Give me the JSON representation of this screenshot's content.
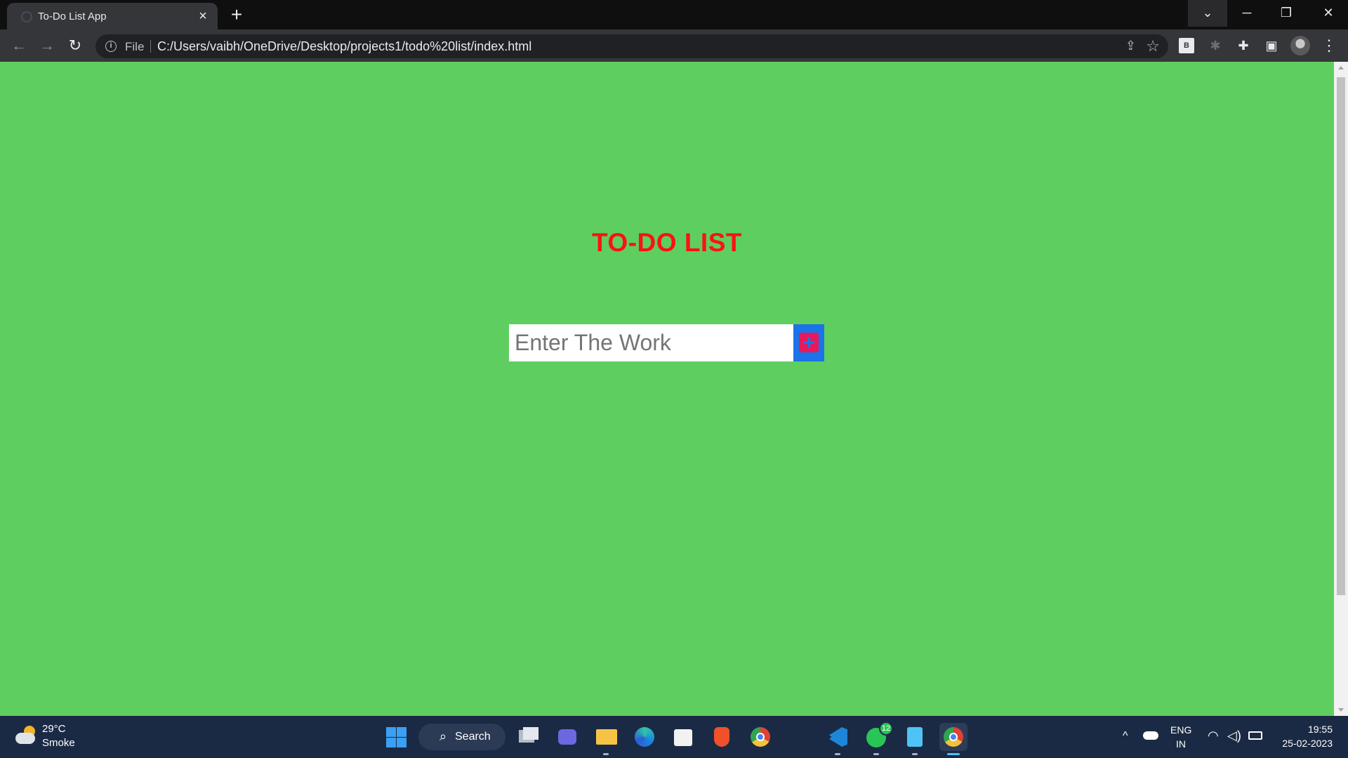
{
  "browser": {
    "tab_title": "To-Do List App",
    "tab_close_icon": "×",
    "new_tab_icon": "+",
    "window_controls": {
      "dropdown": "⌄",
      "minimize": "─",
      "maximize": "❐",
      "close": "✕"
    },
    "nav": {
      "back": "←",
      "forward": "→",
      "reload": "↻"
    },
    "address_bar": {
      "info_icon": "i",
      "scheme_label": "File",
      "url": "C:/Users/vaibh/OneDrive/Desktop/projects1/todo%20list/index.html",
      "share_icon": "⇪",
      "bookmark_icon": "☆"
    },
    "toolbar_icons": {
      "extension_b": "B",
      "extension_grey": "✱",
      "extensions": "✚",
      "side_panel": "▣",
      "menu": "⋮"
    }
  },
  "page": {
    "background_color": "#5fce60",
    "heading": "TO-DO LIST",
    "heading_color": "#ff1111",
    "input": {
      "value": "",
      "placeholder": "Enter The Work"
    },
    "add_button_color": "#1a73e8",
    "add_icon_color": "#e8185a"
  },
  "taskbar": {
    "weather": {
      "temp": "29°C",
      "desc": "Smoke"
    },
    "search_label": "Search",
    "search_icon": "⌕",
    "whatsapp_badge": "12",
    "tray": {
      "chevron": "^",
      "lang_line1": "ENG",
      "lang_line2": "IN",
      "wifi": "◠",
      "volume": "◁)"
    },
    "clock": {
      "time": "19:55",
      "date": "25-02-2023"
    }
  }
}
